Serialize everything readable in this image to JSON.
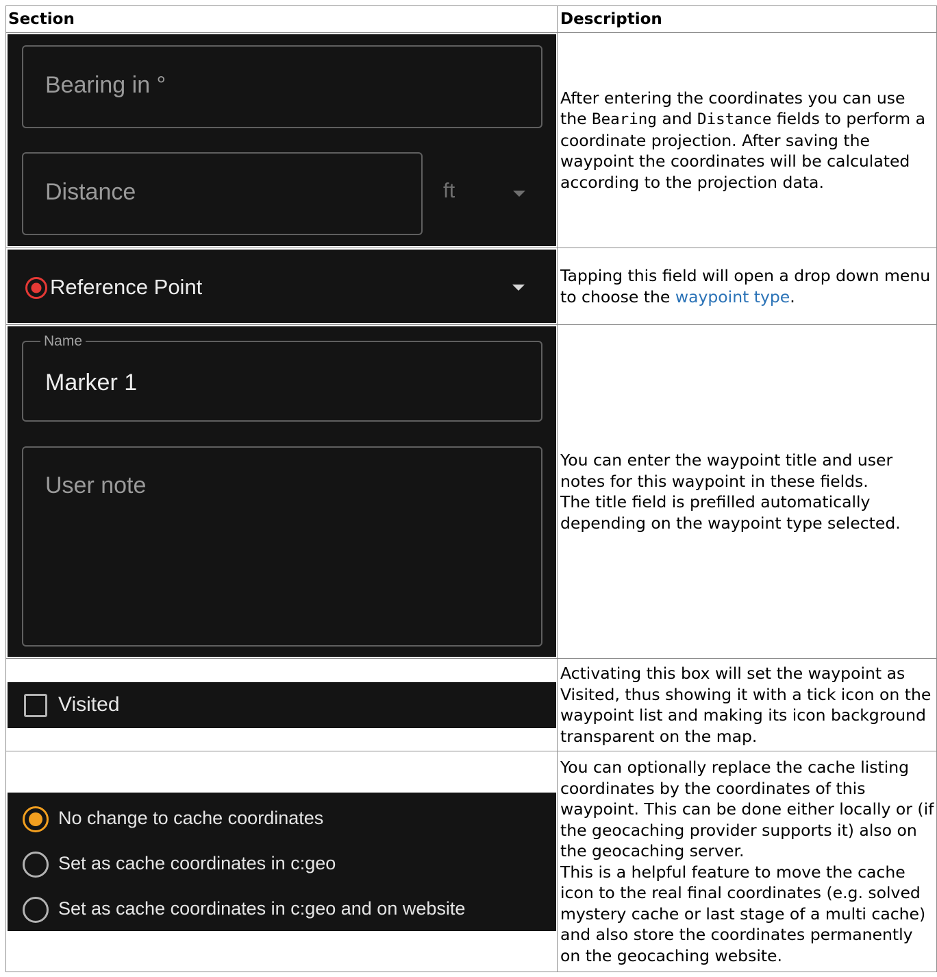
{
  "table": {
    "headers": [
      "Section",
      "Description"
    ]
  },
  "projection": {
    "bearing_placeholder": "Bearing in °",
    "distance_placeholder": "Distance",
    "unit_value": "ft",
    "desc_1": "After entering the coordinates you can use the ",
    "desc_code_bearing": "Bearing",
    "desc_2": " and ",
    "desc_code_distance": "Distance",
    "desc_3": " fields to perform a coordinate projection. After saving the waypoint the coordinates will be calculated according to the projection data."
  },
  "waypoint_type": {
    "selected_value": "Reference Point",
    "desc_1": "Tapping this field will open a drop down menu to choose the ",
    "desc_link": "waypoint type",
    "desc_2": "."
  },
  "name_note": {
    "name_label": "Name",
    "name_value": "Marker 1",
    "note_placeholder": "User note",
    "desc_line1": "You can enter the waypoint title and user notes for this waypoint in these fields.",
    "desc_line2": "The title field is prefilled automatically depending on the waypoint type selected."
  },
  "visited": {
    "label": "Visited",
    "checked": false,
    "desc": "Activating this box will set the waypoint as Visited, thus showing it with a tick icon on the waypoint list and making its icon background transparent on the map."
  },
  "cache_coords": {
    "options": [
      {
        "label": "No change to cache coordinates",
        "selected": true
      },
      {
        "label": "Set as cache coordinates in c:geo",
        "selected": false
      },
      {
        "label": "Set as cache coordinates in c:geo and on website",
        "selected": false
      }
    ],
    "desc_line1": "You can optionally replace the cache listing coordinates by the coordinates of this waypoint. This can be done either locally or (if the geocaching provider supports it) also on the geocaching server.",
    "desc_line2": "This is a helpful feature to move the cache icon to the real final coordinates (e.g. solved mystery cache or last stage of a multi cache) and also store the coordinates permanently on the geocaching website."
  },
  "colors": {
    "screenshot_bg": "#141414",
    "accent_orange": "#f29f1f",
    "reference_red": "#e53935",
    "link_blue": "#2b73b7"
  }
}
